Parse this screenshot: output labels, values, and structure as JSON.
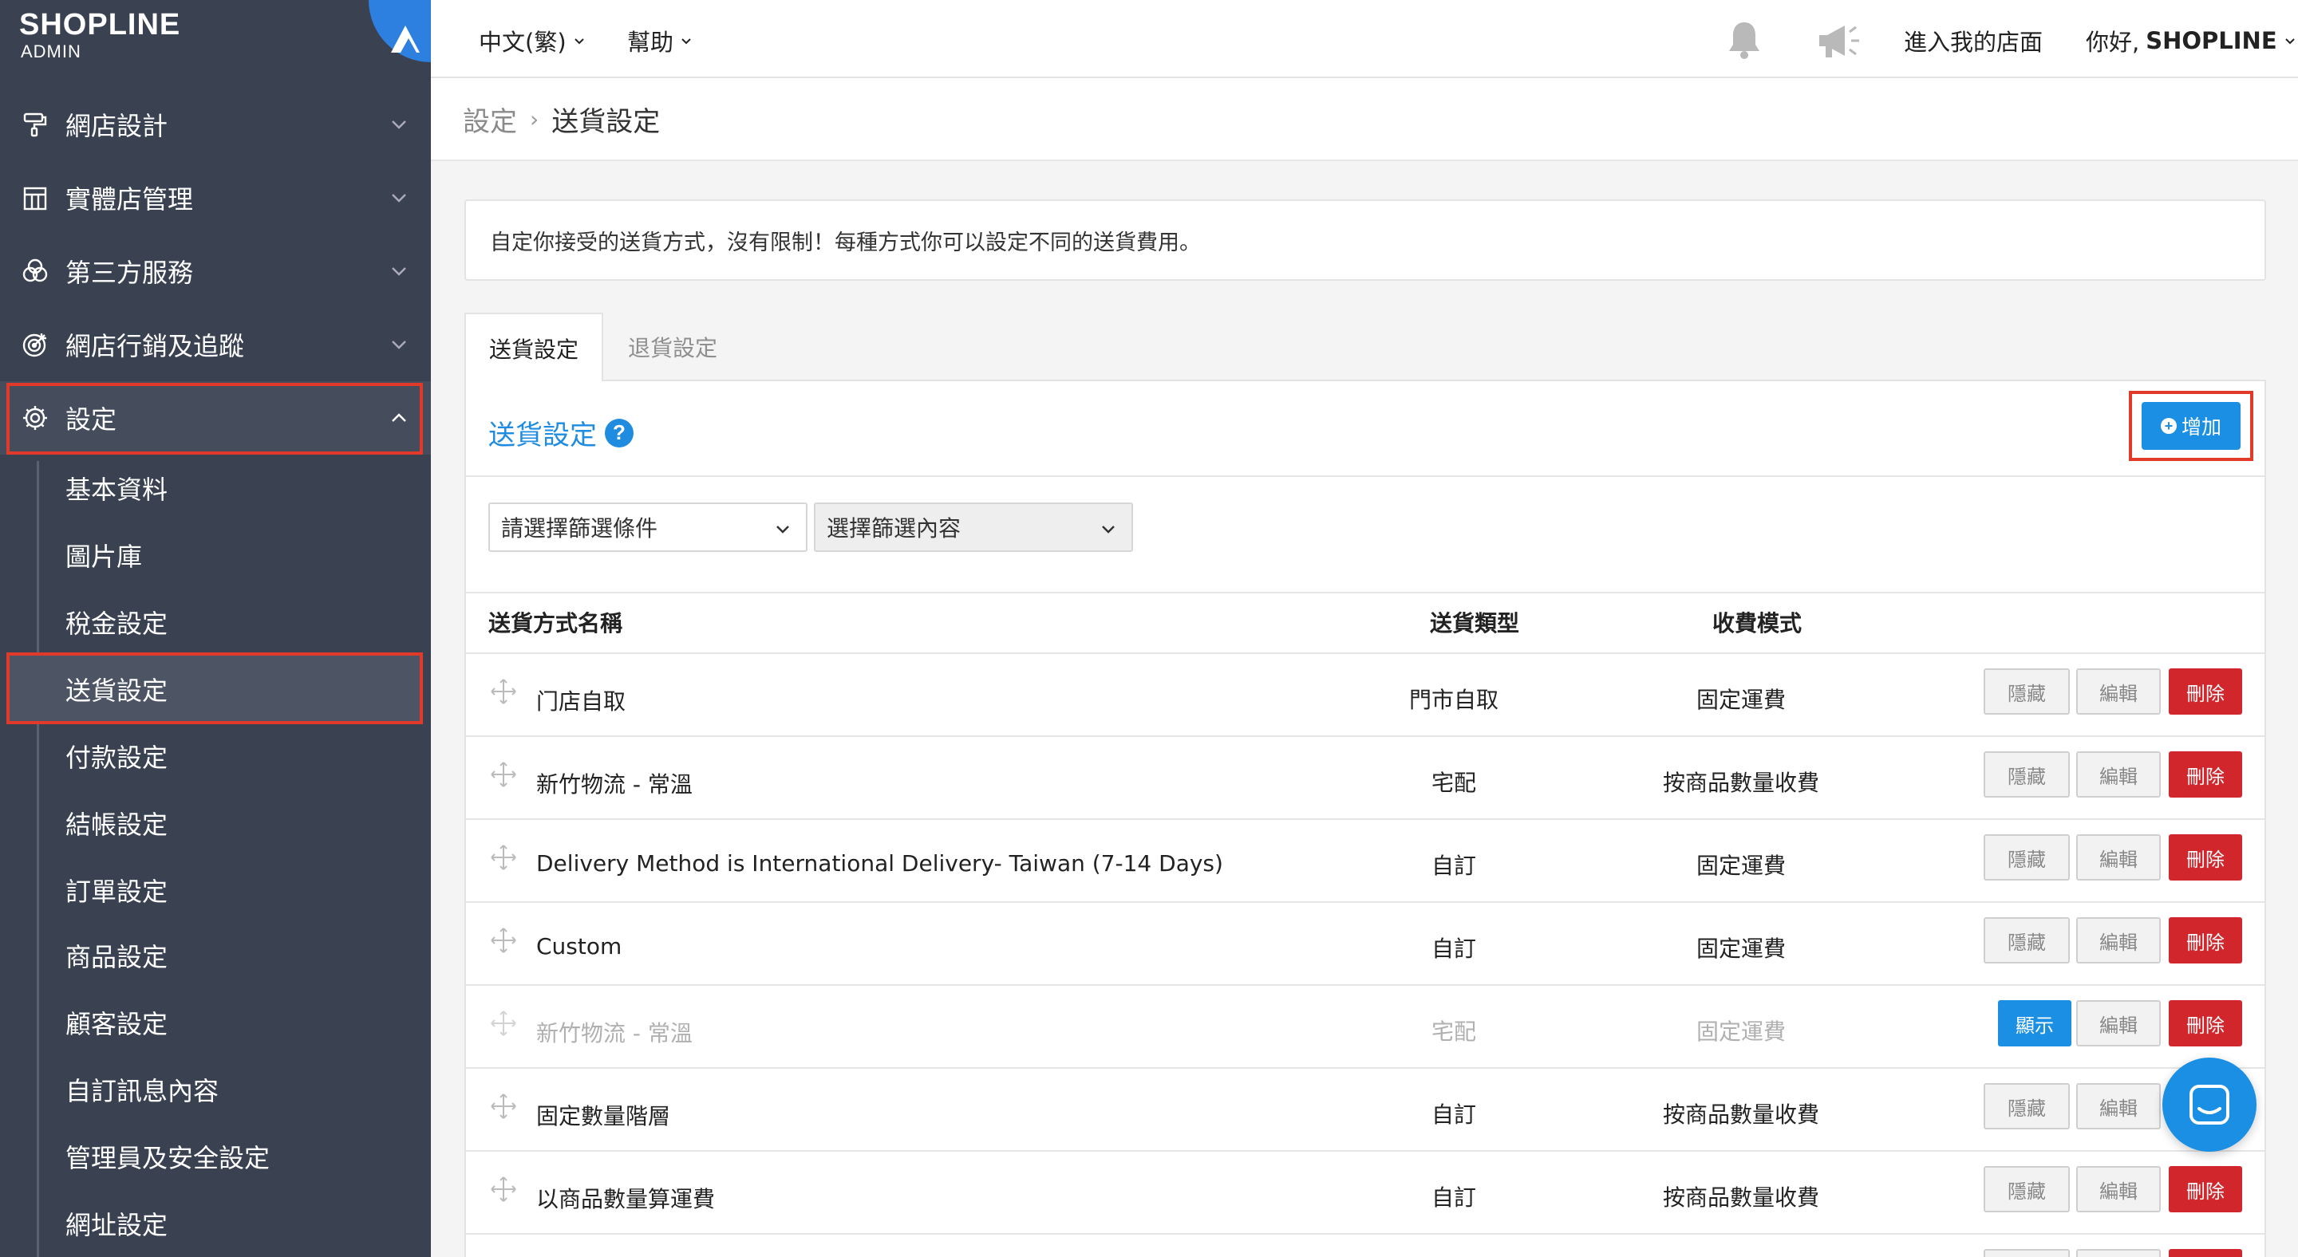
{
  "sidebar": {
    "logo": {
      "word": "SHOPLINE",
      "sub": "ADMIN"
    },
    "menu": [
      {
        "label": "網店設計",
        "icon": "paint-roller-icon"
      },
      {
        "label": "實體店管理",
        "icon": "store-icon"
      },
      {
        "label": "第三方服務",
        "icon": "circles-icon"
      },
      {
        "label": "網店行銷及追蹤",
        "icon": "target-icon"
      },
      {
        "label": "設定",
        "icon": "gear-icon"
      }
    ],
    "submenu": [
      "基本資料",
      "圖片庫",
      "稅金設定",
      "送貨設定",
      "付款設定",
      "結帳設定",
      "訂單設定",
      "商品設定",
      "顧客設定",
      "自訂訊息內容",
      "管理員及安全設定",
      "網址設定"
    ]
  },
  "topbar": {
    "language": "中文(繁)",
    "help": "幫助",
    "visit_store": "進入我的店面",
    "greeting_prefix": "你好,",
    "greeting_name": "SHOPLINE"
  },
  "breadcrumb": {
    "parent": "設定",
    "current": "送貨設定"
  },
  "info_text": "自定你接受的送貨方式，沒有限制！每種方式你可以設定不同的送貨費用。",
  "tabs": {
    "active": "送貨設定",
    "inactive": "退貨設定"
  },
  "panel": {
    "title": "送貨設定",
    "help_symbol": "?",
    "add_label": "增加",
    "filter_condition": "請選擇篩選條件",
    "filter_content": "選擇篩選內容"
  },
  "table": {
    "headers": {
      "name": "送貨方式名稱",
      "type": "送貨類型",
      "fee": "收費模式"
    },
    "buttons": {
      "hide": "隱藏",
      "show": "顯示",
      "edit": "編輯",
      "delete": "刪除"
    },
    "rows": [
      {
        "name": "门店自取",
        "type": "門市自取",
        "fee": "固定運費"
      },
      {
        "name": "新竹物流 - 常溫",
        "type": "宅配",
        "fee": "按商品數量收費"
      },
      {
        "name": "Delivery Method is International Delivery- Taiwan (7-14 Days)",
        "type": "自訂",
        "fee": "固定運費"
      },
      {
        "name": "Custom",
        "type": "自訂",
        "fee": "固定運費"
      },
      {
        "name": "新竹物流 - 常溫",
        "type": "宅配",
        "fee": "固定運費"
      },
      {
        "name": "固定數量階層",
        "type": "自訂",
        "fee": "按商品數量收費"
      },
      {
        "name": "以商品數量算運費",
        "type": "自訂",
        "fee": "按商品數量收費"
      }
    ]
  },
  "colors": {
    "sidebar_bg": "#3a4150",
    "accent_blue": "#1a8fe3",
    "delete_red": "#d0262c",
    "highlight_red": "#e23a2a"
  }
}
